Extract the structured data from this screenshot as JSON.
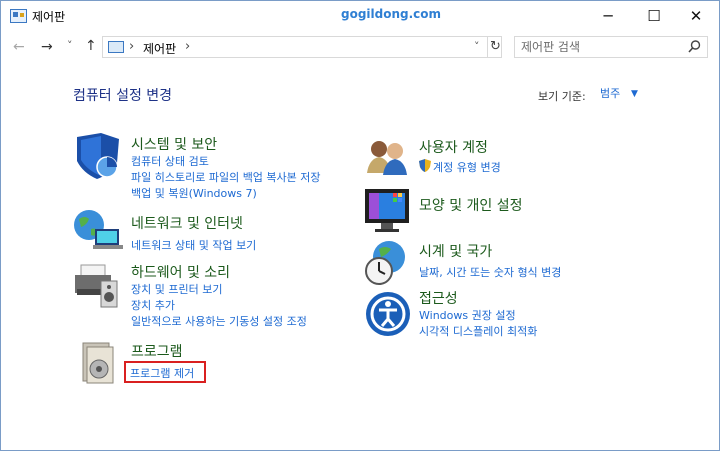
{
  "window": {
    "title": "제어판",
    "watermark": "gogildong.com",
    "minimize": "─",
    "maximize": "☐",
    "close": "✕"
  },
  "toolbar": {
    "back": "←",
    "forward": "→",
    "recent": "˅",
    "up": "↑",
    "breadcrumb_sep1": "›",
    "breadcrumb": "제어판",
    "breadcrumb_sep2": "›",
    "dropdown": "˅",
    "refresh": "↻",
    "search_placeholder": "제어판 검색"
  },
  "main": {
    "heading": "컴퓨터 설정 변경",
    "view_by_label": "보기 기준:",
    "view_by_value": "범주",
    "view_by_caret": "▼"
  },
  "categories": {
    "system": {
      "title": "시스템 및 보안",
      "links": [
        "컴퓨터 상태 검토",
        "파일 히스토리로 파일의 백업 복사본 저장",
        "백업 및 복원(Windows 7)"
      ]
    },
    "network": {
      "title": "네트워크 및 인터넷",
      "links": [
        "네트워크 상태 및 작업 보기"
      ]
    },
    "hardware": {
      "title": "하드웨어 및 소리",
      "links": [
        "장치 및 프린터 보기",
        "장치 추가",
        "일반적으로 사용하는 기동성 설정 조정"
      ]
    },
    "programs": {
      "title": "프로그램",
      "links": [
        "프로그램 제거"
      ]
    },
    "users": {
      "title": "사용자 계정",
      "links": [
        "계정 유형 변경"
      ]
    },
    "appearance": {
      "title": "모양 및 개인 설정",
      "links": []
    },
    "clock": {
      "title": "시계 및 국가",
      "links": [
        "날짜, 시간 또는 숫자 형식 변경"
      ]
    },
    "ease": {
      "title": "접근성",
      "links": [
        "Windows 권장 설정",
        "시각적 디스플레이 최적화"
      ]
    }
  },
  "colors": {
    "link": "#1e6ad2",
    "category_title": "#1c5a1c",
    "heading": "#1e3287",
    "highlight_box": "#d92020"
  }
}
